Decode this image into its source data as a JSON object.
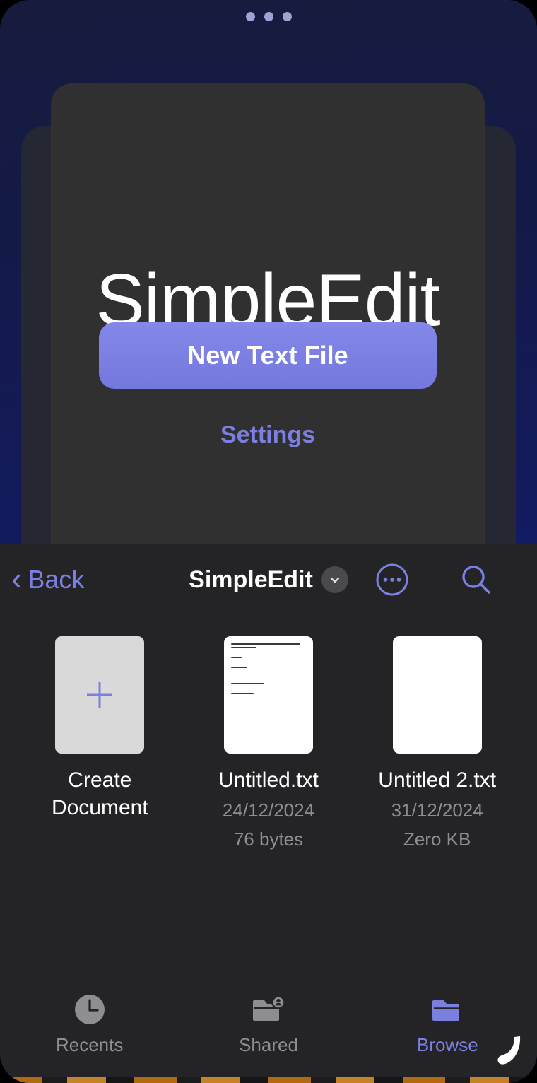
{
  "app": {
    "title": "SimpleEdit",
    "primary_button": "New Text File",
    "settings_link": "Settings",
    "accent_color": "#7b7fe0",
    "card_color": "#303031",
    "backdrop_color": "#131a5e"
  },
  "drag_handle": {
    "dots": 3,
    "icon": "drag-dots-icon"
  },
  "nav": {
    "back_label": "Back",
    "title": "SimpleEdit",
    "chevron_icon": "chevron-down-icon",
    "more_icon": "ellipsis-circle-icon",
    "search_icon": "search-icon"
  },
  "files": [
    {
      "name": "Create Document",
      "date": "",
      "size": "",
      "thumb": "create-document-icon",
      "icon": "plus-icon"
    },
    {
      "name": "Untitled.txt",
      "date": "24/12/2024",
      "size": "76 bytes",
      "thumb": "text-page-with-content"
    },
    {
      "name": "Untitled 2.txt",
      "date": "31/12/2024",
      "size": "Zero KB",
      "thumb": "blank-page"
    }
  ],
  "tabs": [
    {
      "label": "Recents",
      "icon": "clock-icon",
      "active": false
    },
    {
      "label": "Shared",
      "icon": "folder-person-icon",
      "active": false
    },
    {
      "label": "Browse",
      "icon": "folder-filled-icon",
      "active": true
    }
  ]
}
